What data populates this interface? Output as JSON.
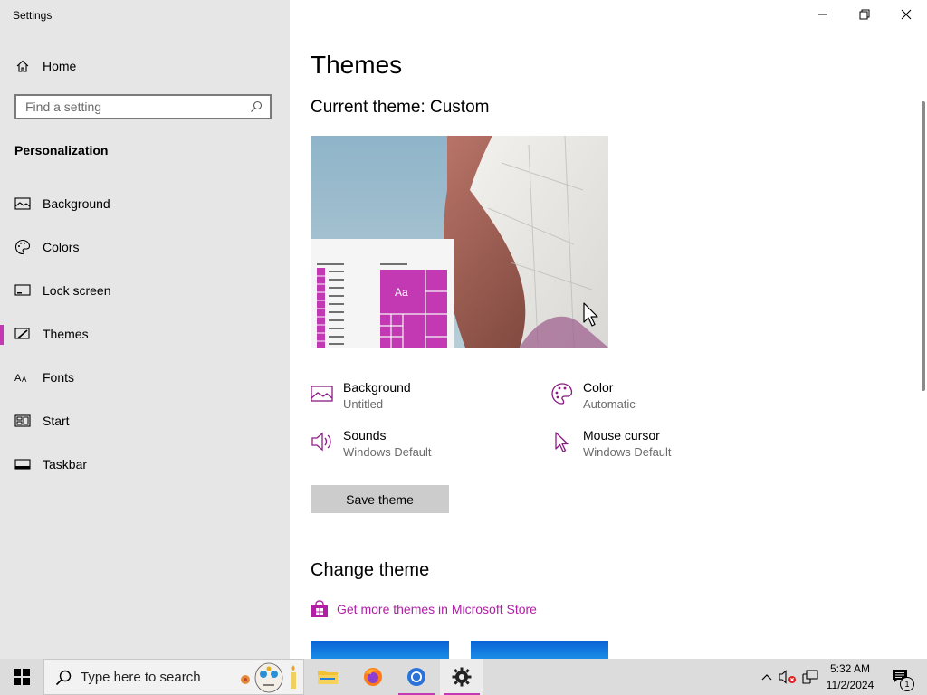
{
  "window": {
    "title": "Settings"
  },
  "sidebar": {
    "home_label": "Home",
    "search_placeholder": "Find a setting",
    "section_label": "Personalization",
    "items": [
      {
        "label": "Background",
        "icon": "picture-icon"
      },
      {
        "label": "Colors",
        "icon": "palette-icon"
      },
      {
        "label": "Lock screen",
        "icon": "lock-screen-icon"
      },
      {
        "label": "Themes",
        "icon": "themes-icon",
        "selected": true
      },
      {
        "label": "Fonts",
        "icon": "fonts-icon"
      },
      {
        "label": "Start",
        "icon": "start-icon"
      },
      {
        "label": "Taskbar",
        "icon": "taskbar-icon"
      }
    ]
  },
  "main": {
    "page_title": "Themes",
    "current_theme": "Current theme: Custom",
    "preview_tile_text": "Aa",
    "settings": [
      {
        "name": "Background",
        "value": "Untitled",
        "icon": "picture-icon"
      },
      {
        "name": "Color",
        "value": "Automatic",
        "icon": "palette-icon"
      },
      {
        "name": "Sounds",
        "value": "Windows Default",
        "icon": "speaker-icon"
      },
      {
        "name": "Mouse cursor",
        "value": "Windows Default",
        "icon": "cursor-icon"
      }
    ],
    "save_button": "Save theme",
    "change_theme_heading": "Change theme",
    "store_link": "Get more themes in Microsoft Store"
  },
  "taskbar": {
    "search_text": "Type here to search",
    "apps": [
      "file-explorer",
      "firefox",
      "chrome",
      "settings"
    ],
    "clock": {
      "time": "5:32 AM",
      "date": "11/2/2024"
    },
    "notification_count": "1"
  },
  "colors": {
    "accent": "#c239b3",
    "link": "#b01fa6",
    "sidebar_bg": "#e6e6e6",
    "taskbar_bg": "#dcdcdc"
  }
}
